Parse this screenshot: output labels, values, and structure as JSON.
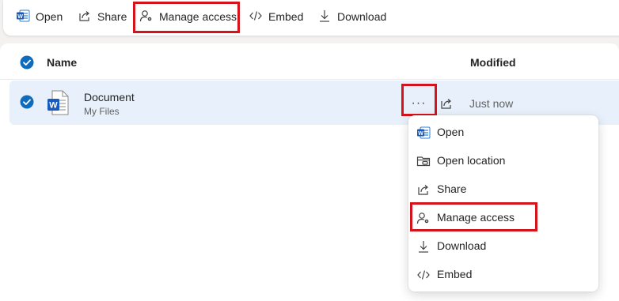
{
  "toolbar": {
    "open_label": "Open",
    "share_label": "Share",
    "manage_access_label": "Manage access",
    "embed_label": "Embed",
    "download_label": "Download"
  },
  "list": {
    "col_name": "Name",
    "col_modified": "Modified",
    "rows": [
      {
        "name": "Document",
        "location": "My Files",
        "modified": "Just now"
      }
    ],
    "more_label": "···"
  },
  "context_menu": {
    "items": [
      {
        "label": "Open",
        "icon": "word-icon"
      },
      {
        "label": "Open location",
        "icon": "folder-location-icon"
      },
      {
        "label": "Share",
        "icon": "share-icon"
      },
      {
        "label": "Manage access",
        "icon": "manage-access-icon"
      },
      {
        "label": "Download",
        "icon": "download-icon"
      },
      {
        "label": "Embed",
        "icon": "embed-icon"
      }
    ]
  },
  "colors": {
    "accent": "#0f6cbd",
    "highlight": "#d4131b",
    "selected_row": "#e8f1fb",
    "word_blue": "#185abd"
  }
}
